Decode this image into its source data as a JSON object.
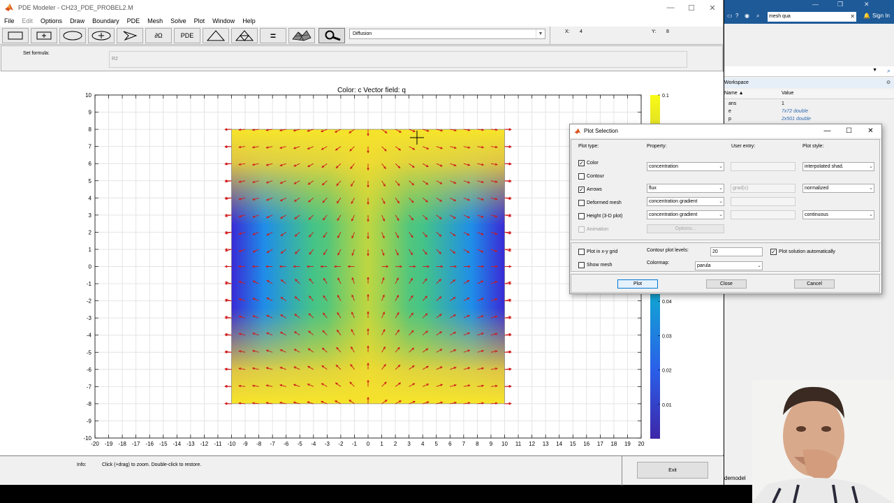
{
  "window": {
    "title": "PDE Modeler - CH23_PDE_PROBEL2.M",
    "controls": [
      "—",
      "☐",
      "✕"
    ]
  },
  "menu": {
    "items": [
      "File",
      "Edit",
      "Options",
      "Draw",
      "Boundary",
      "PDE",
      "Mesh",
      "Solve",
      "Plot",
      "Window",
      "Help"
    ]
  },
  "toolbar": {
    "buttons": [
      "rectangle-tool",
      "rectangle-center-tool",
      "ellipse-tool",
      "ellipse-center-tool",
      "polygon-tool",
      "boundary-mode",
      "pde-spec",
      "mesh-init",
      "mesh-refine",
      "solve",
      "plot-3d",
      "zoom"
    ],
    "boundary_label": "∂Ω",
    "pde_label": "PDE",
    "solve_label": "=",
    "application": "Diffusion",
    "x_label": "X:",
    "x_value": "4",
    "y_label": "Y:",
    "y_value": "8"
  },
  "formula": {
    "label": "Set formula:",
    "value": "R2"
  },
  "plot": {
    "title": "Color: c  Vector field: q",
    "x_ticks": [
      "-20",
      "-19",
      "-18",
      "-17",
      "-16",
      "-15",
      "-14",
      "-13",
      "-12",
      "-11",
      "-10",
      "-9",
      "-8",
      "-7",
      "-6",
      "-5",
      "-4",
      "-3",
      "-2",
      "-1",
      "0",
      "1",
      "2",
      "3",
      "4",
      "5",
      "6",
      "7",
      "8",
      "9",
      "10",
      "11",
      "12",
      "13",
      "14",
      "15",
      "16",
      "17",
      "18",
      "19",
      "20"
    ],
    "y_ticks": [
      "10",
      "9",
      "8",
      "7",
      "6",
      "5",
      "4",
      "3",
      "2",
      "1",
      "0",
      "-1",
      "-2",
      "-3",
      "-4",
      "-5",
      "-6",
      "-7",
      "-8",
      "-9",
      "-10"
    ],
    "colorbar_ticks": [
      "0.1",
      "0.04",
      "0.03",
      "0.02",
      "0.01"
    ]
  },
  "chart_data": {
    "type": "heatmap",
    "title": "Color: c  Vector field: q",
    "xlim": [
      -20,
      20
    ],
    "ylim": [
      -10,
      10
    ],
    "domain_square": {
      "x": [
        -10,
        10
      ],
      "y": [
        -8,
        8
      ]
    },
    "colormap": "parula",
    "colorbar_range": [
      0,
      0.1
    ],
    "grid": true,
    "vector_field": "flux (normalized)"
  },
  "info": {
    "label": "Info:",
    "text": "Click (+drag) to zoom. Double-click to restore.",
    "exit_label": "Exit"
  },
  "matlab": {
    "search_value": "mesh qua",
    "signin": "Sign In",
    "workspace_title": "Workspace",
    "col_name": "Name ▲",
    "col_value": "Value",
    "vars": [
      {
        "name": "ans",
        "value": "1",
        "italic": false
      },
      {
        "name": "e",
        "value": "7x72 double",
        "italic": true
      },
      {
        "name": "p",
        "value": "2x501 double",
        "italic": true
      }
    ],
    "bottom_label": "demodel"
  },
  "dialog": {
    "title": "Plot Selection",
    "headers": {
      "plot_type": "Plot type:",
      "property": "Property:",
      "user_entry": "User entry:",
      "plot_style": "Plot style:"
    },
    "rows": [
      {
        "label": "Color",
        "checked": "✓",
        "property": "concentration",
        "user_entry": "",
        "style": "interpolated shad."
      },
      {
        "label": "Contour",
        "checked": "",
        "property": "",
        "user_entry": "",
        "style": ""
      },
      {
        "label": "Arrows",
        "checked": "✓",
        "property": "flux",
        "user_entry": "grad(c)",
        "style": "normalized"
      },
      {
        "label": "Deformed mesh",
        "checked": "",
        "property": "concentration gradient",
        "user_entry": "",
        "style": ""
      },
      {
        "label": "Height (3-D plot)",
        "checked": "",
        "property": "concentration gradient",
        "user_entry": "",
        "style": "continuous"
      },
      {
        "label": "Animation",
        "checked": "",
        "property": "",
        "user_entry": "",
        "style": ""
      }
    ],
    "options_label": "Options...",
    "plot_in_grid": "Plot in x-y grid",
    "show_mesh": "Show mesh",
    "contour_levels_label": "Contour plot levels:",
    "contour_levels_value": "20",
    "plot_auto_label": "Plot solution automatically",
    "plot_auto_checked": "✓",
    "colormap_label": "Colormap:",
    "colormap_value": "parula",
    "btn_plot": "Plot",
    "btn_close": "Close",
    "btn_cancel": "Cancel"
  },
  "colors": {
    "arrow": "#d01818",
    "field_low": "#3c2dd8",
    "field_mid": "#2fbfa4",
    "field_high": "#f5e42a"
  }
}
